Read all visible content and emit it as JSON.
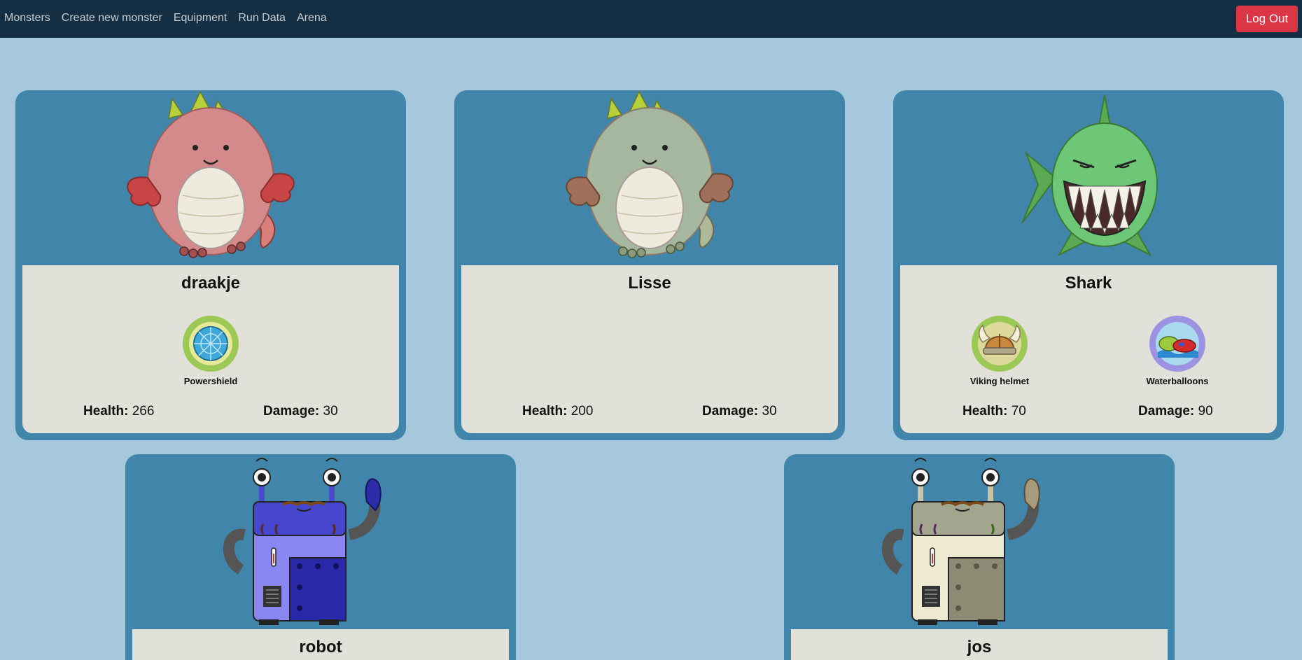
{
  "nav": {
    "links": [
      "Monsters",
      "Create new monster",
      "Equipment",
      "Run Data",
      "Arena"
    ],
    "logout_label": "Log Out"
  },
  "stats_labels": {
    "health": "Health:",
    "damage": "Damage:"
  },
  "monsters": [
    {
      "name": "draakje",
      "art": "red-dragon",
      "health": "266",
      "damage": "30",
      "equipment": [
        {
          "label": "Powershield",
          "icon": "powershield-icon"
        }
      ]
    },
    {
      "name": "Lisse",
      "art": "green-dragon",
      "health": "200",
      "damage": "30",
      "equipment": []
    },
    {
      "name": "Shark",
      "art": "shark",
      "health": "70",
      "damage": "90",
      "equipment": [
        {
          "label": "Viking helmet",
          "icon": "viking-helmet-icon"
        },
        {
          "label": "Waterballoons",
          "icon": "waterballoons-icon"
        }
      ]
    },
    {
      "name": "robot",
      "art": "blue-robot"
    },
    {
      "name": "jos",
      "art": "beige-robot"
    }
  ],
  "colors": {
    "navbar": "#142f43",
    "page_background": "#a5c8dd",
    "card": "#4285aa",
    "card_body": "#e2e1d9",
    "logout": "#dc3545"
  }
}
